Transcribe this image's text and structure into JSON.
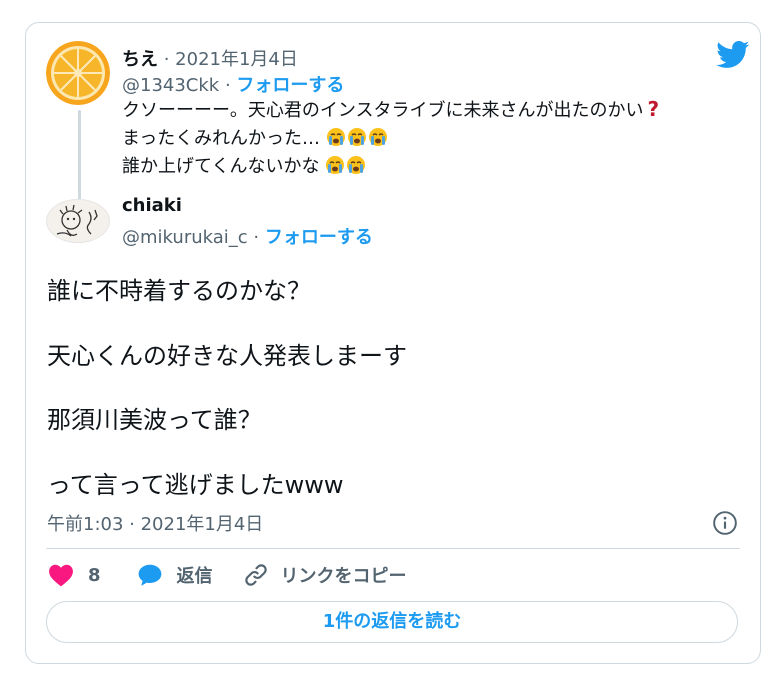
{
  "quoted_tweet": {
    "display_name": "ちえ",
    "date_sep": " · ",
    "date": "2021年1月4日",
    "handle": "@1343Ckk",
    "handle_sep": " · ",
    "follow_label": "フォローする",
    "line1": "クソーーーー。天心君のインスタライブに未来さんが出たのかい",
    "line2": "まったくみれんかった…",
    "line3": "誰か上げてくんないかな"
  },
  "main_tweet": {
    "display_name": "chiaki",
    "handle": "@mikurukai_c",
    "handle_sep": " · ",
    "follow_label": "フォローする",
    "paragraphs": [
      "誰に不時着するのかな？",
      "天心くんの好きな人発表しまーす",
      "那須川美波って誰？",
      "って言って逃げましたwww"
    ],
    "timestamp": "午前1:03 · 2021年1月4日"
  },
  "actions": {
    "like_count": "8",
    "reply_label": "返信",
    "copy_link_label": "リンクをコピー"
  },
  "read_replies_label": "1件の返信を読む",
  "icons": [
    "twitter-bird-icon",
    "heart-icon",
    "speech-bubble-icon",
    "link-icon",
    "info-icon",
    "question-mark-emoji",
    "crying-face-emoji"
  ],
  "colors": {
    "accent": "#1d9bf0",
    "heart": "#f91880",
    "text": "#0f1419",
    "muted": "#536471",
    "border": "#cfd9de",
    "question": "#c0182c"
  }
}
